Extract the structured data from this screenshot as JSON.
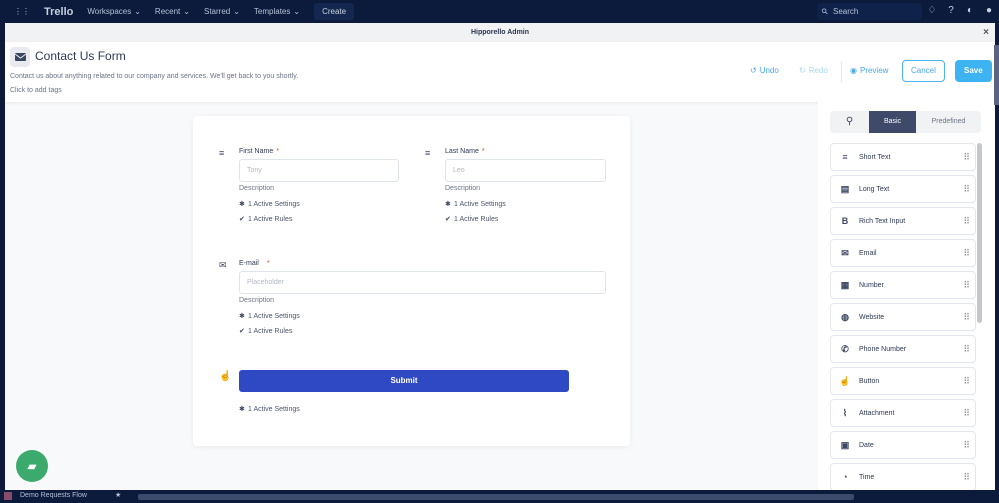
{
  "nav": {
    "logo": "Trello",
    "items": [
      "Workspaces",
      "Recent",
      "Starred",
      "Templates"
    ],
    "create": "Create",
    "search": "Search"
  },
  "modal": {
    "title": "Hipporello Admin",
    "close": "×"
  },
  "header": {
    "title": "Contact Us Form",
    "description": "Contact us about anything related to our company and services. We'll get back to you shortly.",
    "tags": "Click to add tags",
    "undo": "Undo",
    "redo": "Redo",
    "preview": "Preview",
    "cancel": "Cancel",
    "save": "Save"
  },
  "form": {
    "first_name": {
      "label": "First Name",
      "placeholder": "Tony",
      "description": "Description",
      "settings": "1 Active Settings",
      "rules": "1 Active Rules"
    },
    "last_name": {
      "label": "Last Name",
      "placeholder": "Leo",
      "description": "Description",
      "settings": "1 Active Settings",
      "rules": "1 Active Rules"
    },
    "email": {
      "label": "E-mail",
      "placeholder": "Placeholder",
      "description": "Description",
      "settings": "1 Active Settings",
      "rules": "1 Active Rules"
    },
    "required_mark": "*",
    "submit": {
      "label": "Submit",
      "settings": "1 Active Settings"
    }
  },
  "panel": {
    "tabs": [
      "Basic",
      "Predefined"
    ],
    "items": [
      {
        "label": "Short Text",
        "icon": "≡"
      },
      {
        "label": "Long Text",
        "icon": "▤"
      },
      {
        "label": "Rich Text Input",
        "icon": "B"
      },
      {
        "label": "Email",
        "icon": "✉"
      },
      {
        "label": "Number",
        "icon": "▦"
      },
      {
        "label": "Website",
        "icon": "◍"
      },
      {
        "label": "Phone Number",
        "icon": "✆"
      },
      {
        "label": "Button",
        "icon": "☝"
      },
      {
        "label": "Attachment",
        "icon": "⌇"
      },
      {
        "label": "Date",
        "icon": "▣"
      },
      {
        "label": "Time",
        "icon": "◔"
      }
    ]
  },
  "bottom": {
    "board": "Demo Requests Flow"
  }
}
